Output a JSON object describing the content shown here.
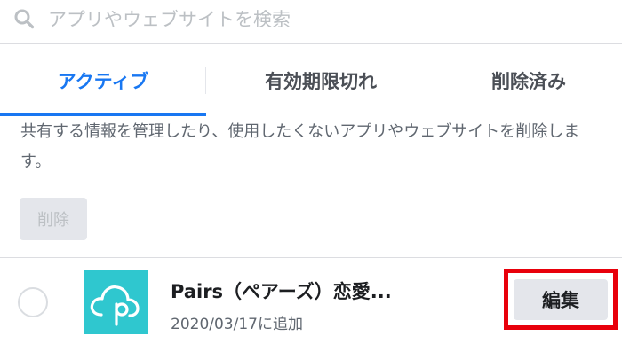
{
  "search": {
    "placeholder": "アプリやウェブサイトを検索",
    "value": "",
    "icon": "search-icon"
  },
  "tabs": [
    {
      "label": "アクティブ",
      "active": true
    },
    {
      "label": "有効期限切れ",
      "active": false
    },
    {
      "label": "削除済み",
      "active": false
    }
  ],
  "description": "共有する情報を管理したり、使用したくないアプリやウェブサイトを削除します。",
  "delete_button": {
    "label": "削除",
    "enabled": false
  },
  "apps": [
    {
      "name": "Pairs（ペアーズ）恋愛...",
      "added": "2020/03/17に追加",
      "icon": "pairs-logo-icon",
      "selected": false,
      "edit_label": "編集"
    }
  ],
  "colors": {
    "accent": "#1877f2",
    "highlight": "#e8000b",
    "app_icon_bg": "#2fc7cf"
  }
}
